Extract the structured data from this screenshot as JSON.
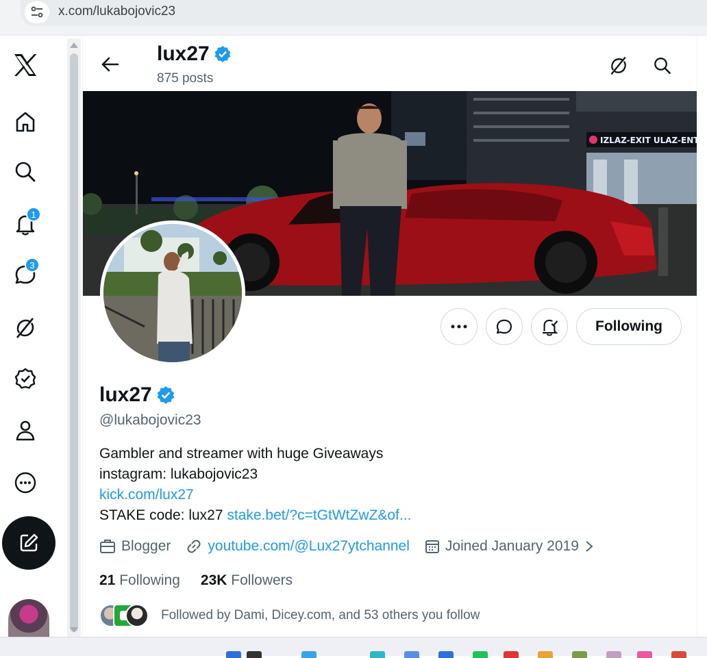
{
  "browser": {
    "url": "x.com/lukabojovic23"
  },
  "nav": {
    "notifications_badge": "1",
    "messages_badge": "3"
  },
  "profile": {
    "header_name": "lux27",
    "posts_count": "875 posts",
    "display_name": "lux27",
    "handle": "@lukabojovic23",
    "bio": {
      "line1": "Gambler and streamer with huge Giveaways",
      "line2": "instagram: lukabojovic23",
      "link1": "kick.com/lux27",
      "line4_prefix": "STAKE code: lux27 ",
      "link2": "stake.bet/?c=tGtWtZwZ&of..."
    },
    "category": "Blogger",
    "website": "youtube.com/@Lux27ytchannel",
    "joined": "Joined January 2019",
    "following_count": "21",
    "following_label": "Following",
    "followers_count": "23K",
    "followers_label": "Followers",
    "followed_by": "Followed by Dami, Dicey.com, and 53 others you follow",
    "follow_button": "Following"
  },
  "colors": {
    "accent": "#1d9bf0",
    "text": "#0f1419",
    "secondary": "#536471"
  }
}
